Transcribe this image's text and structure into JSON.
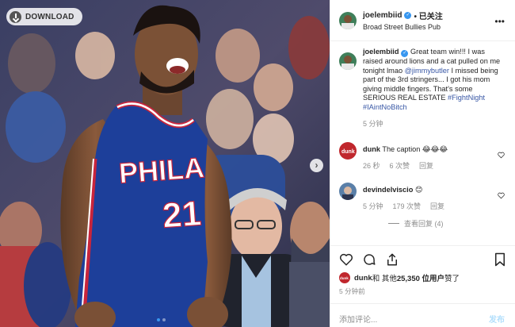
{
  "media": {
    "download_label": "DOWNLOAD",
    "jersey_team": "PHILA",
    "jersey_number": "21",
    "carousel_next": "›",
    "carousel_count": 2,
    "carousel_active": 1
  },
  "header": {
    "username": "joelembiid",
    "following": "• 已关注",
    "location": "Broad Street Bullies Pub",
    "more": "•••"
  },
  "caption": {
    "username": "joelembiid",
    "text1": " Great team win!!! I was raised around lions and a cat pulled on me tonight lmao ",
    "mention": "@jimmybutler",
    "text2": " I missed being part of the 3rd stringers... I got his mom giving middle fingers. That's some SERIOUS REAL ESTATE ",
    "hashtag1": "#FightNight",
    "hashtag2": "#IAintNoBitch",
    "time": "5 分钟"
  },
  "comments": [
    {
      "username": "dunk",
      "text": " The caption 😂😂😂",
      "time": "26 秒",
      "likes": "6 次赞",
      "reply": "回复"
    },
    {
      "username": "devindelviscio",
      "text": " 😊",
      "time": "5 分钟",
      "likes": "179 次赞",
      "reply": "回复",
      "view_replies": "查看回复 (4)"
    }
  ],
  "likes": {
    "user": "dunk",
    "text": " 和 其他 ",
    "count": "25,350 位用户",
    "suffix": " 赞了"
  },
  "timestamp": "5 分钟前",
  "add_comment": {
    "placeholder": "添加评论...",
    "post": "发布"
  },
  "colors": {
    "accent": "#3897f0",
    "link": "#3857a5",
    "jersey": "#1d3f9a",
    "muted": "#8e8e8e"
  }
}
